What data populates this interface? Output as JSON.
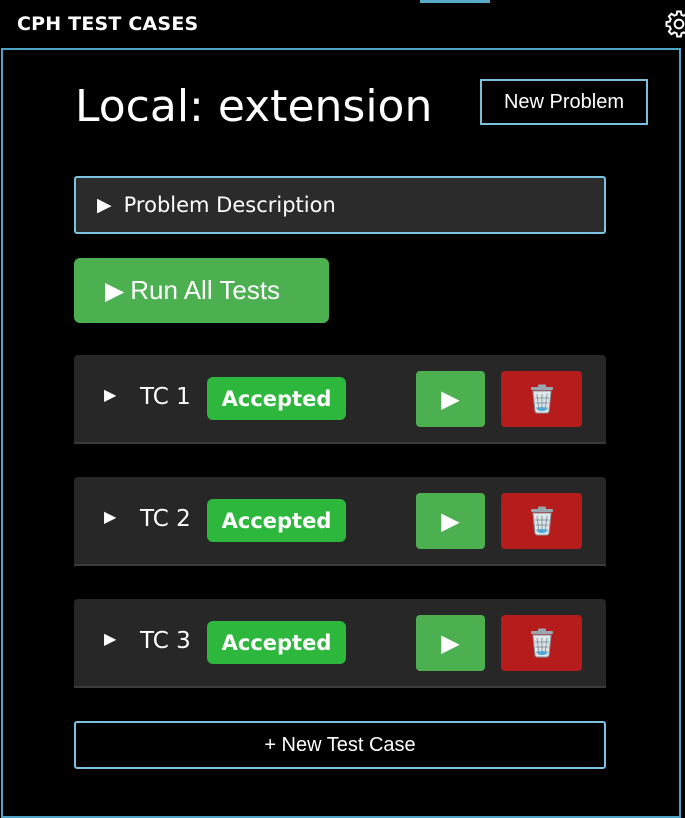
{
  "header": {
    "title": "CPH TEST CASES",
    "settings_icon": "gear-icon"
  },
  "main": {
    "title": "Local: extension",
    "new_problem_label": "New Problem",
    "problem_description": {
      "arrow": "▶",
      "label": "Problem Description"
    },
    "run_all": {
      "icon": "▶",
      "label": "Run All Tests"
    },
    "test_cases": [
      {
        "toggle": "▶",
        "name": "TC 1",
        "status": "Accepted",
        "run_icon": "▶"
      },
      {
        "toggle": "▶",
        "name": "TC 2",
        "status": "Accepted",
        "run_icon": "▶"
      },
      {
        "toggle": "▶",
        "name": "TC 3",
        "status": "Accepted",
        "run_icon": "▶"
      }
    ],
    "new_test_case_label": "+ New Test Case"
  },
  "colors": {
    "background": "#000000",
    "accent_border": "#4fa3c7",
    "run_green": "#4caf50",
    "accepted_green": "#2db83d",
    "delete_red": "#b71c1c",
    "row_bg": "#272727"
  }
}
